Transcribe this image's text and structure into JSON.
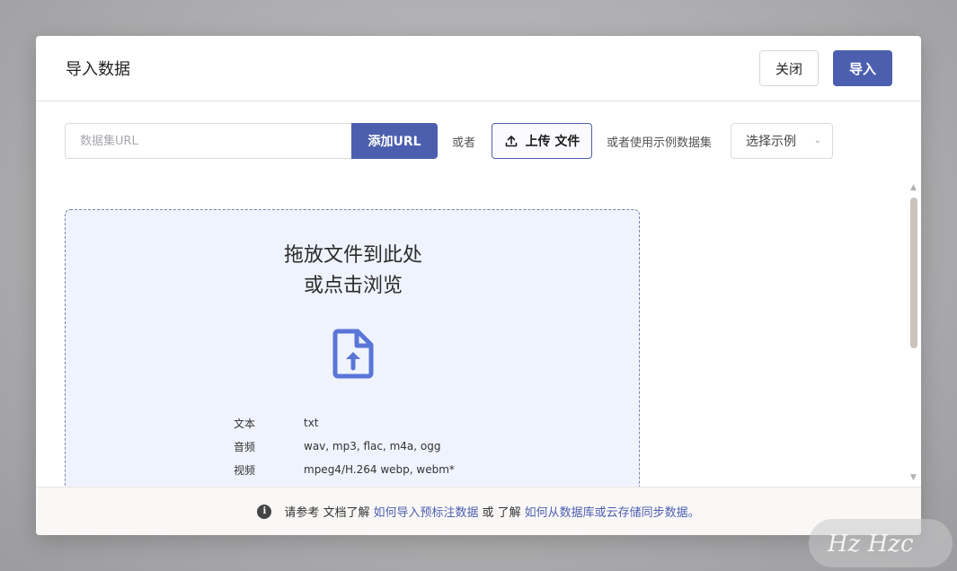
{
  "dialog": {
    "title": "导入数据",
    "close_label": "关闭",
    "import_label": "导入"
  },
  "toolbar": {
    "url_placeholder": "数据集URL",
    "url_value": "",
    "add_url_label": "添加URL",
    "or_text": "或者",
    "upload_label": "上传 文件",
    "or_sample_text": "或者使用示例数据集",
    "sample_select_value": "选择示例"
  },
  "dropzone": {
    "title_line1": "拖放文件到此处",
    "title_line2": "或点击浏览",
    "formats": [
      {
        "type": "文本",
        "ext": "txt"
      },
      {
        "type": "音频",
        "ext": "wav, mp3, flac, m4a, ogg"
      },
      {
        "type": "视频",
        "ext": "mpeg4/H.264 webp, webm*"
      }
    ]
  },
  "footer": {
    "prefix": "请参考 文档了解",
    "link1": "如何导入预标注数据",
    "middle": "或 了解",
    "link2": "如何从数据库或云存储同步数据。"
  },
  "colors": {
    "primary": "#4c5faf",
    "dropzone_bg": "#eff3fd"
  },
  "icons": {
    "upload": "upload-icon",
    "file_upload": "file-upload-icon",
    "info": "info-icon",
    "chevron": "chevron-down-icon"
  }
}
